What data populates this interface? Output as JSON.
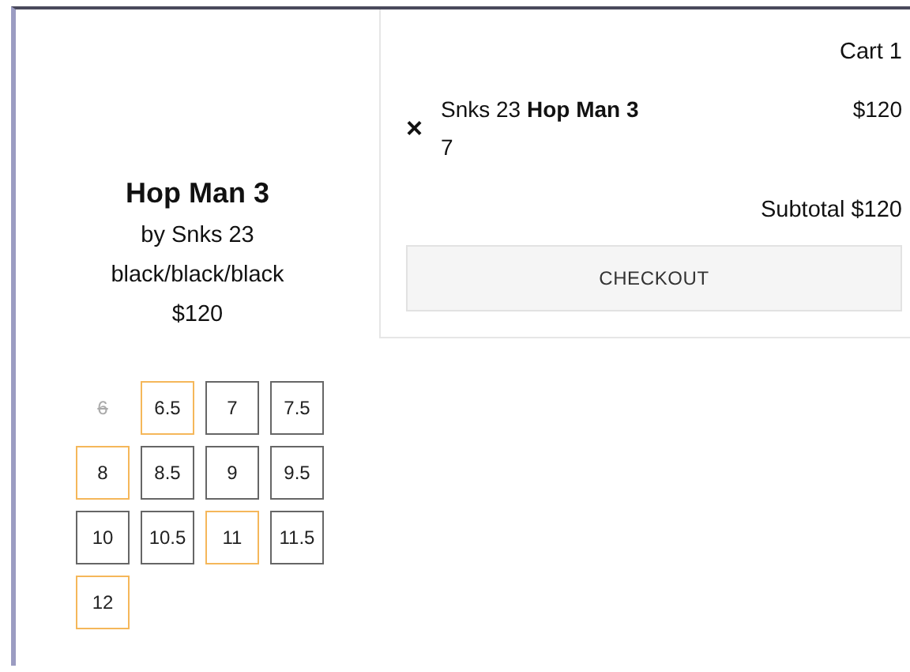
{
  "product": {
    "title": "Hop Man 3",
    "brand": "by Snks 23",
    "colorway": "black/black/black",
    "price": "$120"
  },
  "sizes": [
    {
      "label": "6",
      "disabled": true,
      "highlighted": false
    },
    {
      "label": "6.5",
      "disabled": false,
      "highlighted": true
    },
    {
      "label": "7",
      "disabled": false,
      "highlighted": false
    },
    {
      "label": "7.5",
      "disabled": false,
      "highlighted": false
    },
    {
      "label": "8",
      "disabled": false,
      "highlighted": true
    },
    {
      "label": "8.5",
      "disabled": false,
      "highlighted": false
    },
    {
      "label": "9",
      "disabled": false,
      "highlighted": false
    },
    {
      "label": "9.5",
      "disabled": false,
      "highlighted": false
    },
    {
      "label": "10",
      "disabled": false,
      "highlighted": false
    },
    {
      "label": "10.5",
      "disabled": false,
      "highlighted": false
    },
    {
      "label": "11",
      "disabled": false,
      "highlighted": true
    },
    {
      "label": "11.5",
      "disabled": false,
      "highlighted": false
    },
    {
      "label": "12",
      "disabled": false,
      "highlighted": true
    }
  ],
  "cart": {
    "title": "Cart 1",
    "items": [
      {
        "remove": "×",
        "name": "Snks 23 **Hop Man 3**",
        "size": "7",
        "price": "$120"
      }
    ],
    "subtotal": "Subtotal $120",
    "checkout": "CHECKOUT"
  }
}
